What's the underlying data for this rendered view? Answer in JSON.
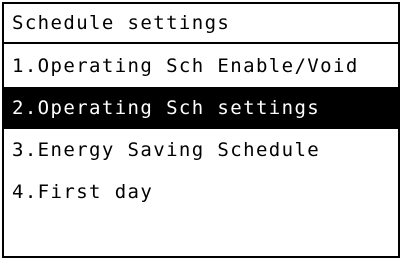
{
  "screen": {
    "title": "Schedule settings"
  },
  "menu": {
    "items": [
      {
        "label": "1.Operating Sch Enable/Void",
        "selected": false
      },
      {
        "label": "2.Operating Sch settings",
        "selected": true
      },
      {
        "label": "3.Energy Saving Schedule",
        "selected": false
      },
      {
        "label": "4.First day",
        "selected": false
      }
    ]
  },
  "colors": {
    "background": "#ffffff",
    "text": "#000000",
    "selected_background": "#000000",
    "selected_text": "#ffffff",
    "border": "#000000"
  }
}
